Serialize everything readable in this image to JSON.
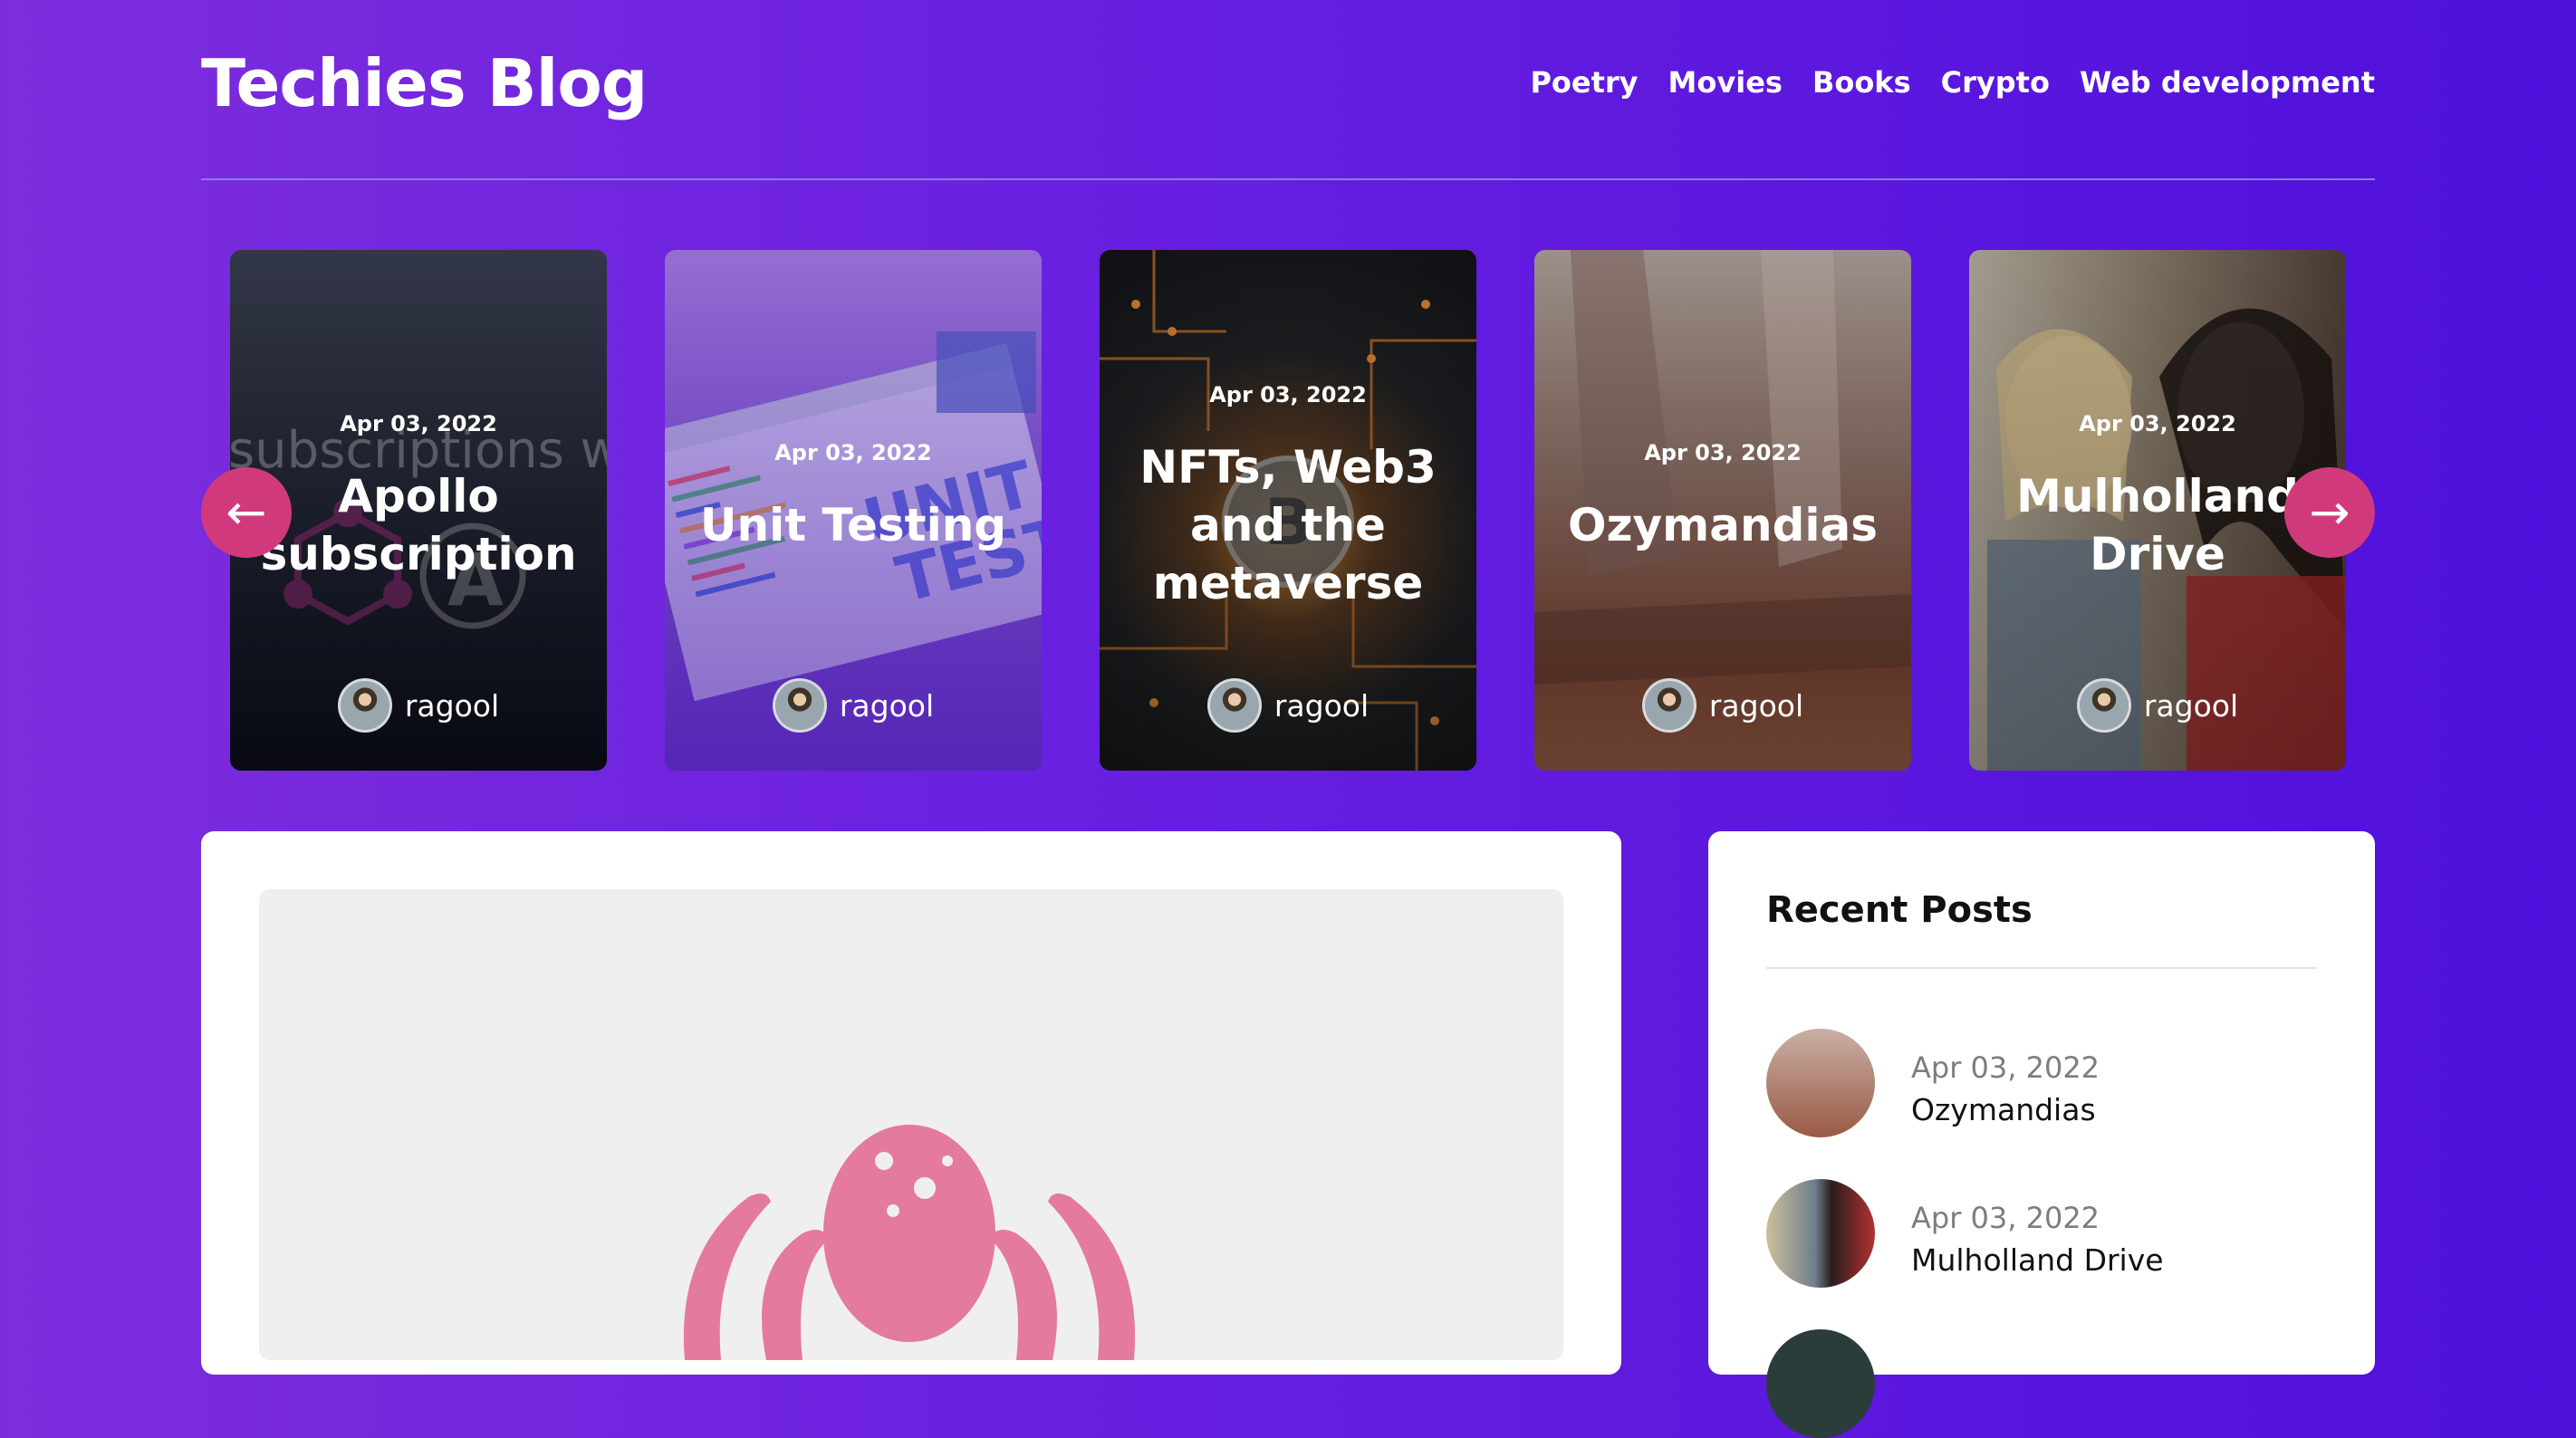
{
  "site": {
    "title": "Techies Blog"
  },
  "nav": {
    "items": [
      "Poetry",
      "Movies",
      "Books",
      "Crypto",
      "Web development"
    ]
  },
  "carousel": {
    "prev_label": "←",
    "next_label": "→",
    "cards": [
      {
        "date": "Apr 03, 2022",
        "title": "Apollo subscription",
        "author": "ragool",
        "bg_word": "subscriptions w",
        "colors": [
          "#3b4154",
          "#0c0f1c"
        ]
      },
      {
        "date": "Apr 03, 2022",
        "title": "Unit Testing",
        "author": "ragool",
        "bg_word": "UNIT TESTS",
        "colors": [
          "#9b7bd2",
          "#5b2fb6"
        ]
      },
      {
        "date": "Apr 03, 2022",
        "title": "NFTs, Web3 and the metaverse",
        "author": "ragool",
        "bg_word": "",
        "colors": [
          "#3b3b3b",
          "#151515"
        ]
      },
      {
        "date": "Apr 03, 2022",
        "title": "Ozymandias",
        "author": "ragool",
        "bg_word": "",
        "colors": [
          "#a89388",
          "#7d4432"
        ]
      },
      {
        "date": "Apr 03, 2022",
        "title": "Mulholland Drive",
        "author": "ragool",
        "bg_word": "",
        "colors": [
          "#b9b3a5",
          "#6b5648"
        ]
      }
    ]
  },
  "sidebar": {
    "title": "Recent Posts",
    "posts": [
      {
        "date": "Apr 03, 2022",
        "title": "Ozymandias"
      },
      {
        "date": "Apr 03, 2022",
        "title": "Mulholland Drive"
      }
    ]
  },
  "colors": {
    "accent": "#d03a7d",
    "octopus": "#e47aa0",
    "panel": "#ffffff"
  }
}
